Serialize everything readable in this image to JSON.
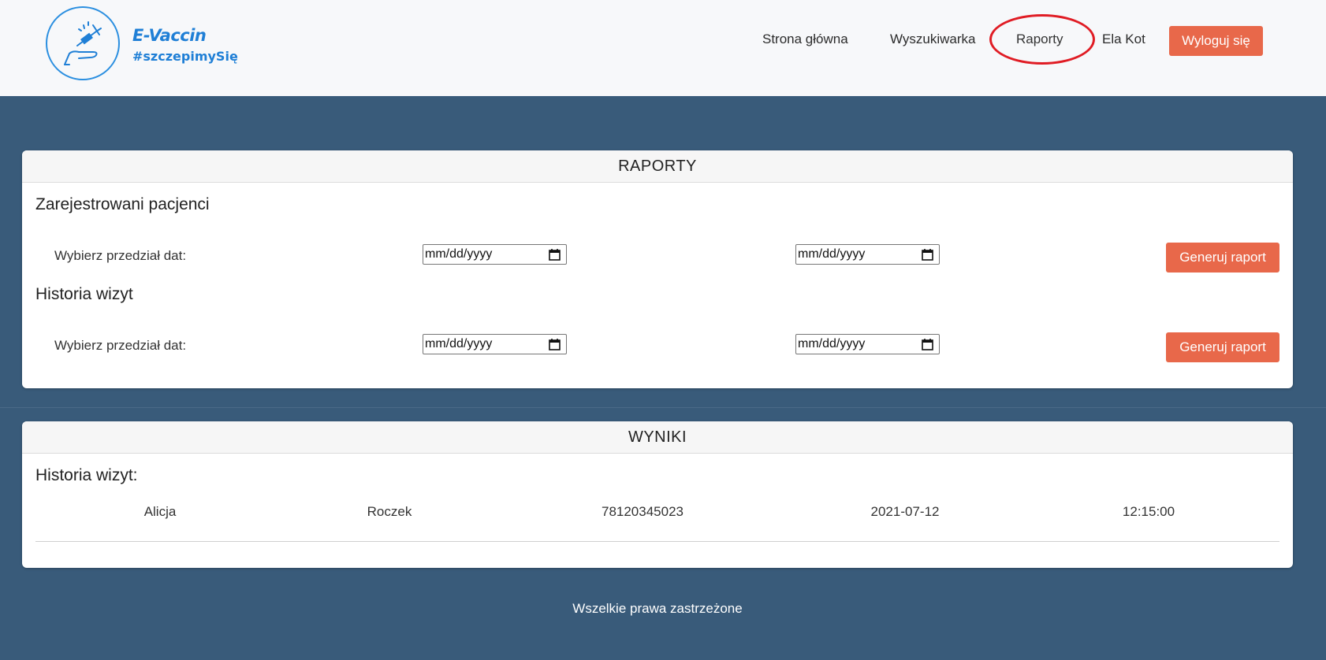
{
  "brand": {
    "name": "E-Vaccin",
    "tagline": "#szczepimySię"
  },
  "nav": {
    "items": [
      {
        "label": "Strona główna"
      },
      {
        "label": "Wyszukiwarka"
      },
      {
        "label": "Raporty",
        "highlighted": true
      },
      {
        "label": "Ela Kot"
      }
    ],
    "logout_label": "Wyloguj się"
  },
  "reports": {
    "header": "RAPORTY",
    "sections": [
      {
        "title": "Zarejestrowani pacjenci",
        "range_label": "Wybierz przedział dat:",
        "from_placeholder": "mm/dd/yyyy",
        "to_placeholder": "mm/dd/yyyy",
        "button_label": "Generuj raport"
      },
      {
        "title": "Historia wizyt",
        "range_label": "Wybierz przedział dat:",
        "from_placeholder": "mm/dd/yyyy",
        "to_placeholder": "mm/dd/yyyy",
        "button_label": "Generuj raport"
      }
    ]
  },
  "results": {
    "header": "WYNIKI",
    "title": "Historia wizyt:",
    "rows": [
      [
        "Alicja",
        "Roczek",
        "78120345023",
        "2021-07-12",
        "12:15:00"
      ]
    ]
  },
  "footer": {
    "text": "Wszelkie prawa zastrzeżone"
  },
  "colors": {
    "page_bg": "#395b7a",
    "accent_button": "#e8684a",
    "brand_blue": "#1f7fd6",
    "highlight_circle": "#e01c24"
  }
}
